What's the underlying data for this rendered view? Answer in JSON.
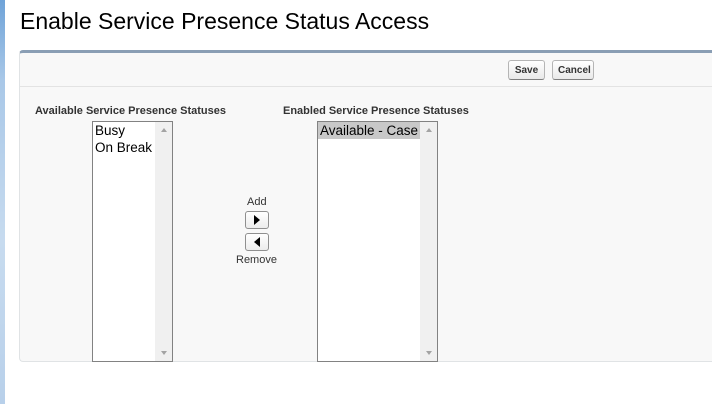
{
  "page": {
    "title": "Enable Service Presence Status Access"
  },
  "toolbar": {
    "save_label": "Save",
    "cancel_label": "Cancel"
  },
  "available": {
    "label": "Available Service Presence Statuses",
    "items": [
      "Busy",
      "On Break"
    ]
  },
  "enabled": {
    "label": "Enabled Service Presence Statuses",
    "items": [
      "Available - Case"
    ],
    "selected_index": 0
  },
  "mover": {
    "add_label": "Add",
    "remove_label": "Remove"
  },
  "icons": {
    "add_arrow": "triangle-right-icon",
    "remove_arrow": "triangle-left-icon",
    "scroll_up": "scroll-up-icon",
    "scroll_down": "scroll-down-icon"
  },
  "colors": {
    "panel_top_border": "#8a9eb4",
    "panel_background": "#f8f8f8",
    "selected_item": "#c8c8c8"
  }
}
